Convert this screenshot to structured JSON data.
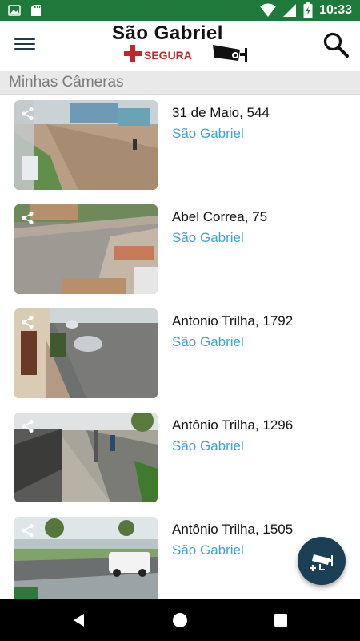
{
  "status_bar": {
    "time": "10:33",
    "icons": [
      "image-icon",
      "sd-card-icon",
      "wifi-icon",
      "signal-icon",
      "battery-charging-icon"
    ],
    "background": "#1e7a3a"
  },
  "app_bar": {
    "logo_title": "São Gabriel",
    "logo_subtitle": "SEGURA",
    "menu_icon": "hamburger-menu-icon",
    "search_icon": "search-icon"
  },
  "section": {
    "title": "Minhas Câmeras"
  },
  "cameras": [
    {
      "address": "31 de Maio, 544",
      "city": "São Gabriel"
    },
    {
      "address": "Abel Correa, 75",
      "city": "São Gabriel"
    },
    {
      "address": "Antonio Trilha, 1792",
      "city": "São Gabriel"
    },
    {
      "address": "Antônio Trilha, 1296",
      "city": "São Gabriel"
    },
    {
      "address": "Antônio Trilha, 1505",
      "city": "São Gabriel"
    }
  ],
  "fab": {
    "icon": "add-camera-icon",
    "background": "#1b3f55"
  },
  "nav_bar": {
    "icons": [
      "back-icon",
      "home-icon",
      "recents-icon"
    ]
  },
  "colors": {
    "accent": "#3aa6cc",
    "brand_red": "#c0262a",
    "section_bg": "#e9e9ea"
  }
}
